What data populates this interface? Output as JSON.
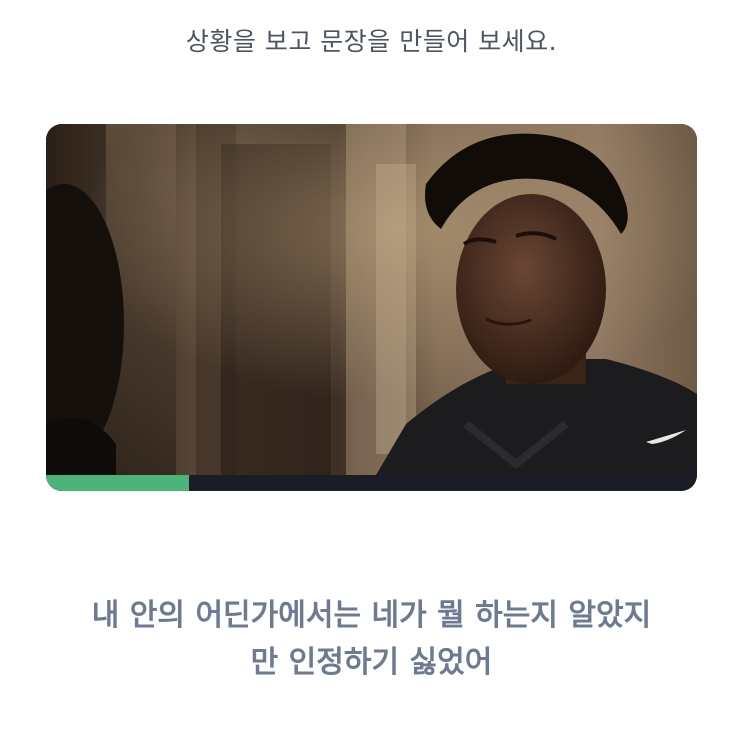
{
  "instruction": "상황을 보고 문장을 만들어 보세요.",
  "video": {
    "progress": 0.22,
    "progress_color": "#4cb37a",
    "track_color": "#1b1d26"
  },
  "sentence": {
    "line1": "내 안의 어딘가에서는 네가 뭘 하는지 알았지",
    "line2": "만 인정하기 싫었어"
  },
  "colors": {
    "instruction": "#4b5563",
    "sentence": "#6d7a92"
  }
}
